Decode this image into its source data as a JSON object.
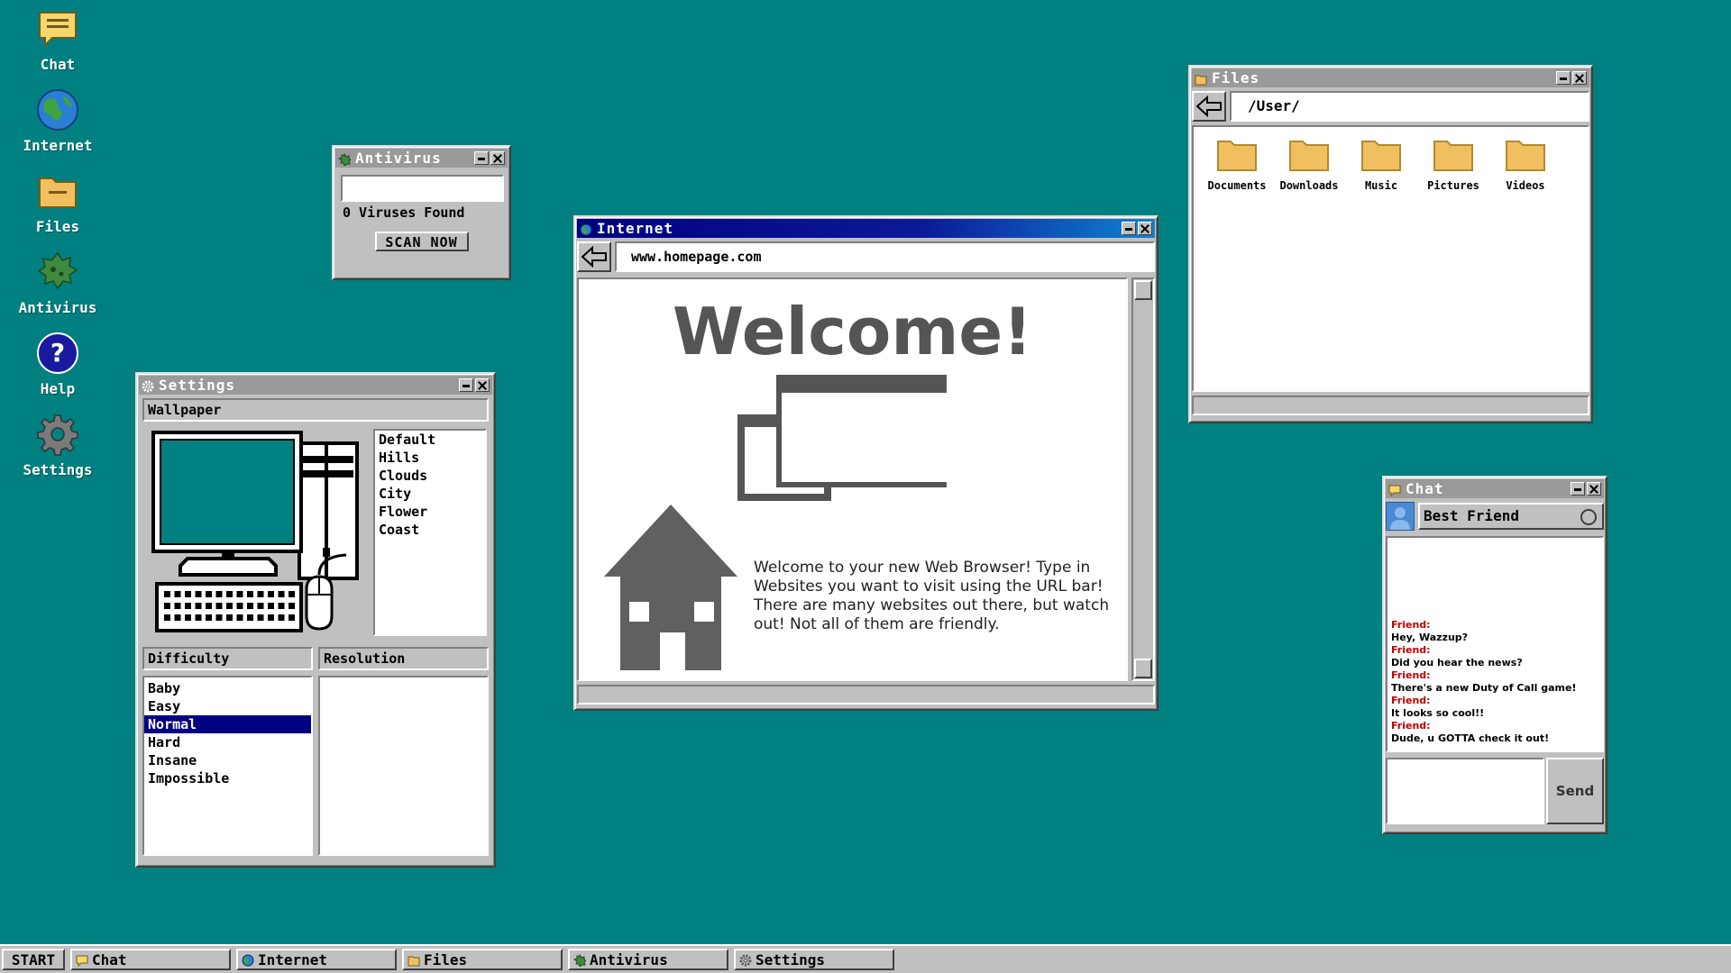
{
  "desktop": {
    "background": "#008080",
    "icons": [
      {
        "label": "Chat",
        "icon": "chat-icon"
      },
      {
        "label": "Internet",
        "icon": "globe-icon"
      },
      {
        "label": "Files",
        "icon": "folder-icon"
      },
      {
        "label": "Antivirus",
        "icon": "virus-icon"
      },
      {
        "label": "Help",
        "icon": "help-icon"
      },
      {
        "label": "Settings",
        "icon": "gear-icon"
      }
    ]
  },
  "antivirus": {
    "title": "Antivirus",
    "status": "0 Viruses Found",
    "scan_button": "SCAN NOW"
  },
  "settings": {
    "title": "Settings",
    "wallpaper_header": "Wallpaper",
    "wallpapers": [
      "Default",
      "Hills",
      "Clouds",
      "City",
      "Flower",
      "Coast"
    ],
    "difficulty_header": "Difficulty",
    "difficulties": [
      "Baby",
      "Easy",
      "Normal",
      "Hard",
      "Insane",
      "Impossible"
    ],
    "selected_difficulty": "Normal",
    "resolution_header": "Resolution",
    "wallpaper_preview_color": "#008080"
  },
  "internet": {
    "title": "Internet",
    "url": "www.homepage.com",
    "heading": "Welcome!",
    "body": "Welcome to your new Web Browser! Type in Websites you want to visit using the URL bar! There are many websites out there, but watch out! Not all of them are friendly."
  },
  "files": {
    "title": "Files",
    "path": "/User/",
    "folders": [
      "Documents",
      "Downloads",
      "Music",
      "Pictures",
      "Videos"
    ]
  },
  "chat": {
    "title": "Chat",
    "contact": "Best Friend",
    "messages": [
      {
        "from": "Friend:",
        "text": "Hey, Wazzup?"
      },
      {
        "from": "Friend:",
        "text": "Did you hear the news?"
      },
      {
        "from": "Friend:",
        "text": "There's a new Duty of Call game!"
      },
      {
        "from": "Friend:",
        "text": "It looks so cool!!"
      },
      {
        "from": "Friend:",
        "text": "Dude, u GOTTA check it out!"
      }
    ],
    "send_button": "Send"
  },
  "taskbar": {
    "start": "START",
    "tasks": [
      {
        "label": "Chat",
        "icon": "chat-icon"
      },
      {
        "label": "Internet",
        "icon": "globe-icon"
      },
      {
        "label": "Files",
        "icon": "folder-icon"
      },
      {
        "label": "Antivirus",
        "icon": "virus-icon"
      },
      {
        "label": "Settings",
        "icon": "gear-icon"
      }
    ]
  },
  "colors": {
    "desktop": "#008080",
    "active_title": "#000080",
    "inactive_title": "#9a9a9a",
    "folder": "#f0c060",
    "chat_name": "#c00000"
  }
}
